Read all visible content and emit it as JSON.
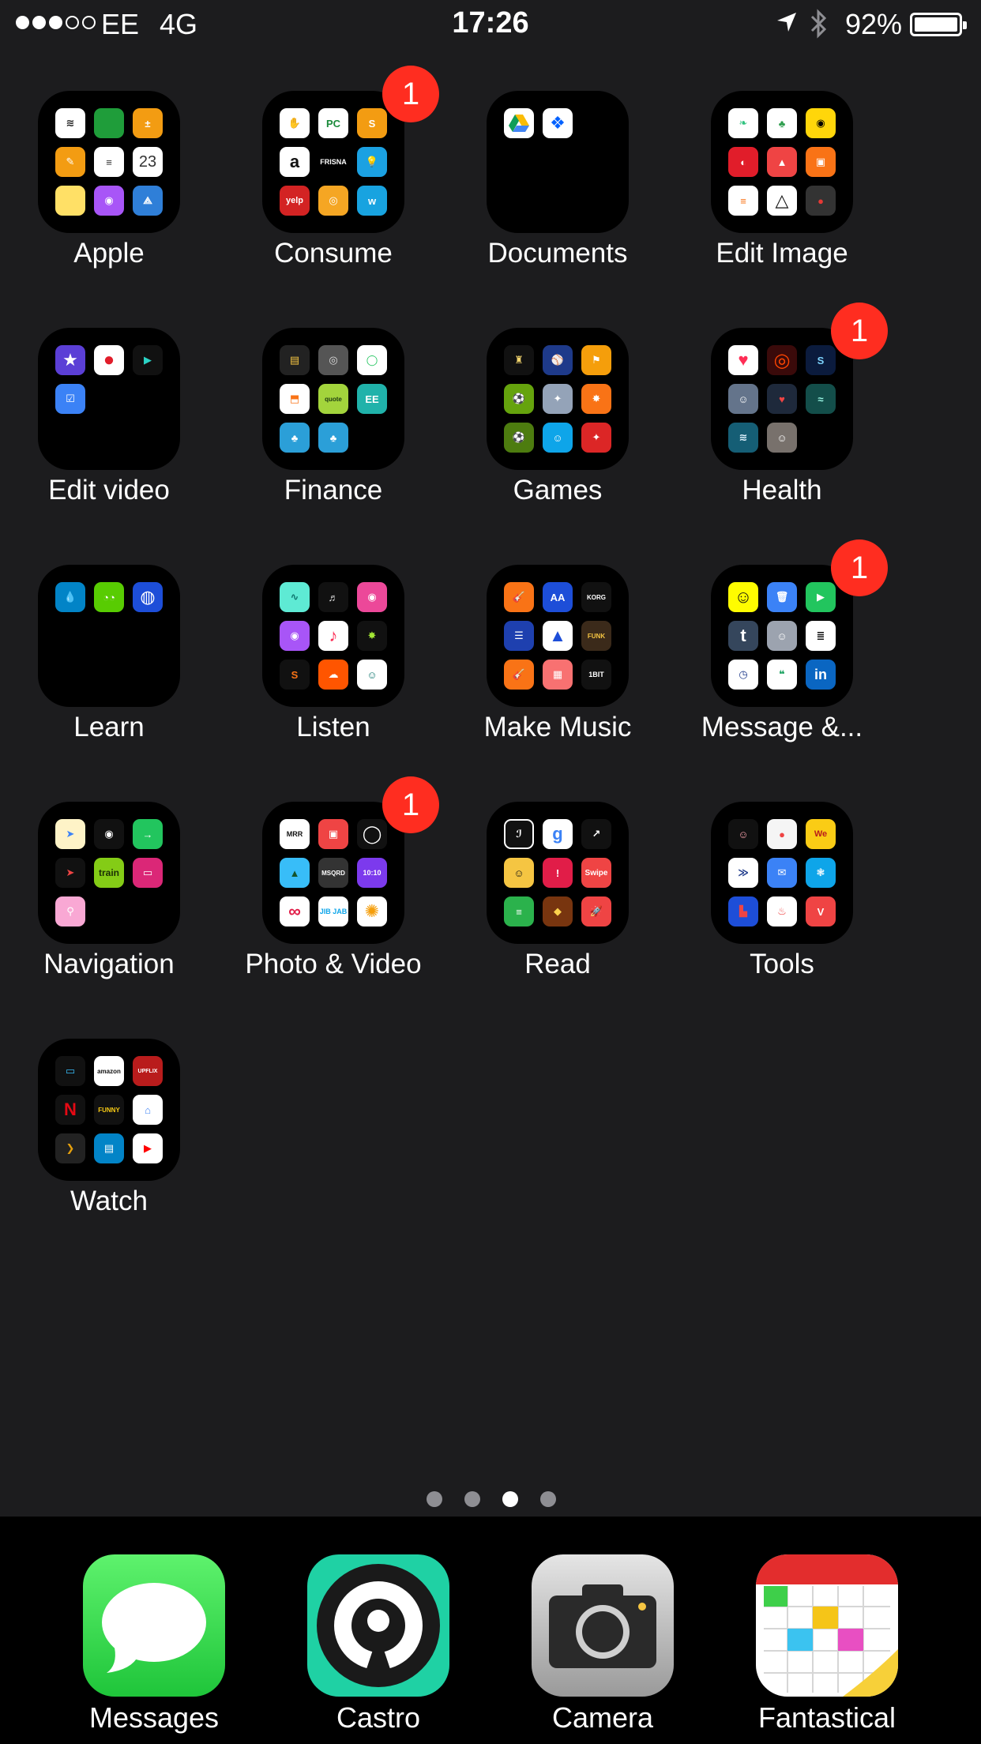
{
  "status_bar": {
    "carrier": "EE",
    "network": "4G",
    "time": "17:26",
    "battery": "92%",
    "signal_strength": 3,
    "icons": [
      "location-icon",
      "bluetooth-icon",
      "battery-icon"
    ]
  },
  "folders": [
    {
      "name": "Apple",
      "badge": ""
    },
    {
      "name": "Consume",
      "badge": "1"
    },
    {
      "name": "Documents",
      "badge": ""
    },
    {
      "name": "Edit Image",
      "badge": ""
    },
    {
      "name": "Edit video",
      "badge": ""
    },
    {
      "name": "Finance",
      "badge": ""
    },
    {
      "name": "Games",
      "badge": ""
    },
    {
      "name": "Health",
      "badge": "1"
    },
    {
      "name": "Learn",
      "badge": ""
    },
    {
      "name": "Listen",
      "badge": ""
    },
    {
      "name": "Make Music",
      "badge": ""
    },
    {
      "name": "Message &...",
      "badge": "1"
    },
    {
      "name": "Navigation",
      "badge": ""
    },
    {
      "name": "Photo & Video",
      "badge": "1"
    },
    {
      "name": "Read",
      "badge": ""
    },
    {
      "name": "Tools",
      "badge": ""
    },
    {
      "name": "Watch",
      "badge": ""
    }
  ],
  "mini_text": {
    "consume_frisna": "FRISNA",
    "consume_yelp": "yelp",
    "apple_calendar": "23",
    "make_music_1bit": "1BIT",
    "make_music_korg": "KORG",
    "make_music_funk": "FUNK",
    "navigation_train": "train",
    "photo_mrr": "MRR",
    "photo_jibjab": "JIB JAB",
    "read_swipe": "Swipe",
    "watch_amazon": "amazon",
    "watch_funny": "FUNNY"
  },
  "page_indicator": {
    "count": 4,
    "active": 3
  },
  "dock": [
    {
      "name": "Messages",
      "icon": "messages-icon"
    },
    {
      "name": "Castro",
      "icon": "castro-icon"
    },
    {
      "name": "Camera",
      "icon": "camera-icon"
    },
    {
      "name": "Fantastical",
      "icon": "fantastical-icon"
    }
  ]
}
